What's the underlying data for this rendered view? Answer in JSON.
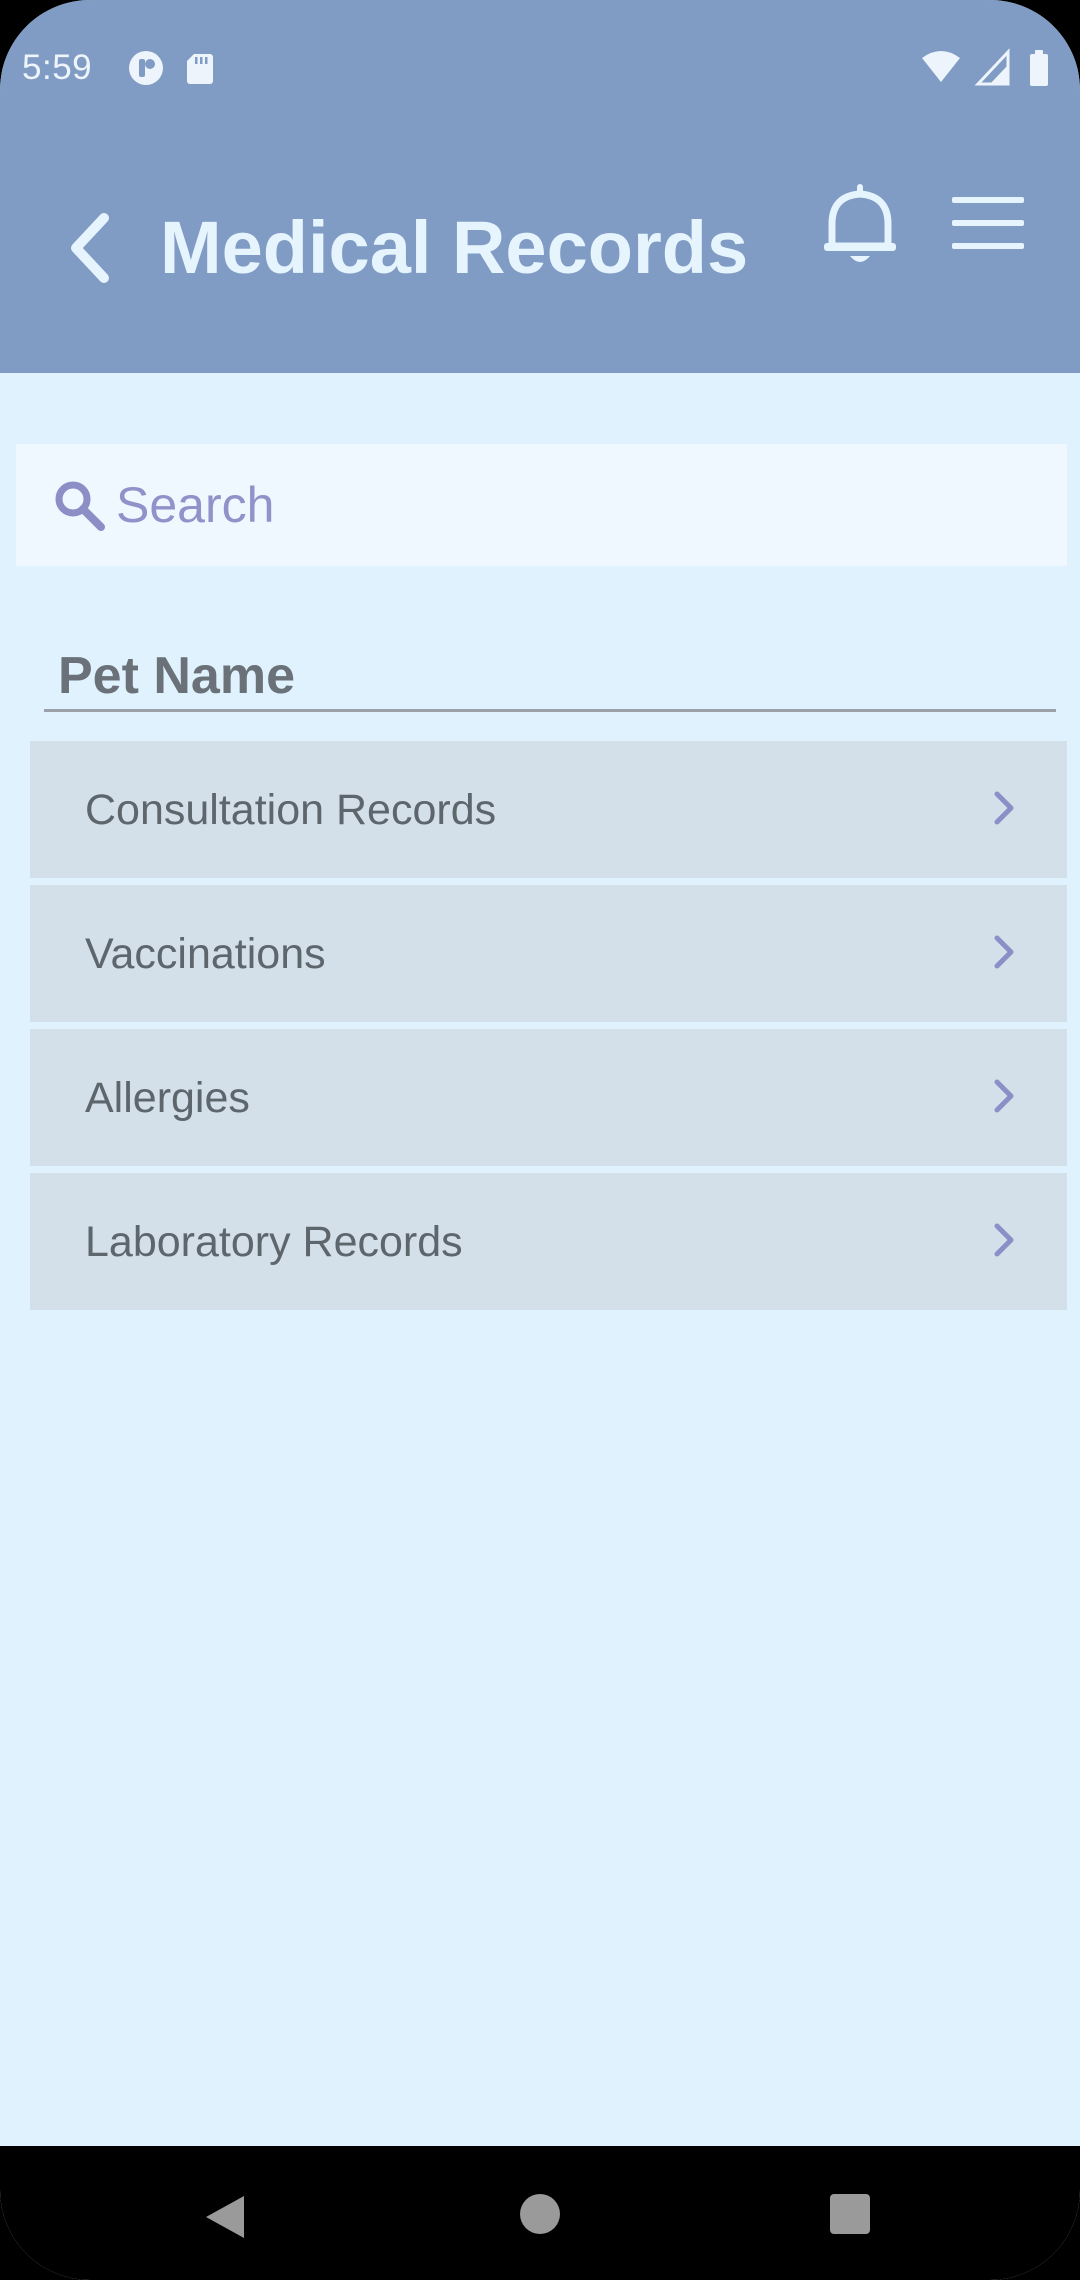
{
  "status_bar": {
    "time": "5:59"
  },
  "app_bar": {
    "title": "Medical Records",
    "back_icon": "chevron-left-icon",
    "notification_icon": "bell-icon",
    "menu_icon": "hamburger-menu-icon"
  },
  "search": {
    "placeholder": "Search",
    "value": "",
    "icon": "search-icon"
  },
  "pet": {
    "name_label": "Pet Name"
  },
  "records": [
    {
      "label": "Consultation Records"
    },
    {
      "label": "Vaccinations"
    },
    {
      "label": "Allergies"
    },
    {
      "label": "Laboratory Records"
    }
  ],
  "nav_bar": {
    "back": "nav-back-icon",
    "home": "nav-home-icon",
    "recents": "nav-recents-icon"
  },
  "colors": {
    "app_bar": "#809cc4",
    "background": "#e0f2fd",
    "list_item": "#d3e0e9",
    "accent": "#8b8fc6"
  }
}
